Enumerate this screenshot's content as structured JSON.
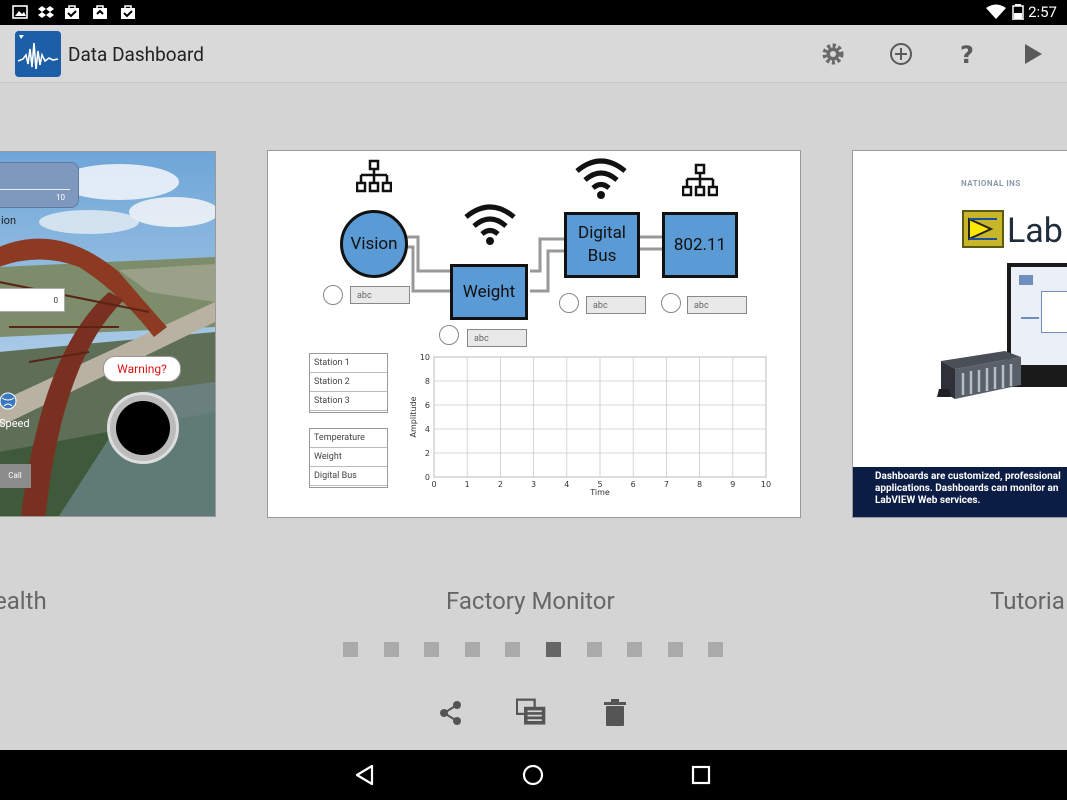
{
  "status_bar": {
    "time": "2:57"
  },
  "app_bar": {
    "title": "Data Dashboard",
    "actions": [
      "settings-icon",
      "add-icon",
      "help-icon",
      "play-icon"
    ]
  },
  "left_card": {
    "label": "ealth",
    "gauge_max": "10",
    "text_fragment": "ion",
    "numeric_value": "0",
    "warning_text": "Warning?",
    "speed_text": "Speed",
    "call_button": "Call"
  },
  "center_card": {
    "label": "Factory Monitor",
    "nodes": [
      "Vision",
      "Weight",
      "Digital Bus",
      "802.11"
    ],
    "text_fields": [
      "abc",
      "abc",
      "abc",
      "abc"
    ],
    "station_list": [
      "Station 1",
      "Station 2",
      "Station 3"
    ],
    "measure_list": [
      "Temperature",
      "Weight",
      "Digital Bus"
    ],
    "chart": {
      "ylabel": "Amplitude",
      "xlabel": "Time",
      "yticks": [
        "10",
        "8",
        "6",
        "4",
        "2",
        "0"
      ],
      "xticks": [
        "0",
        "1",
        "2",
        "3",
        "4",
        "5",
        "6",
        "7",
        "8",
        "9",
        "10"
      ]
    }
  },
  "right_card": {
    "label": "Tutoria",
    "brand_small": "NATIONAL INS",
    "brand_big": "Lab",
    "caption_line1": "Dashboards are customized, professional",
    "caption_line2": "applications. Dashboards can monitor an",
    "caption_line3": "LabVIEW Web services."
  },
  "pager": {
    "count": 10,
    "active_index": 5
  },
  "bottom_actions": [
    "share-icon",
    "duplicate-icon",
    "delete-icon"
  ],
  "chart_data": {
    "type": "line",
    "xlabel": "Time",
    "ylabel": "Amplitude",
    "xlim": [
      0,
      10
    ],
    "ylim": [
      0,
      10
    ],
    "grid": true,
    "series": []
  }
}
